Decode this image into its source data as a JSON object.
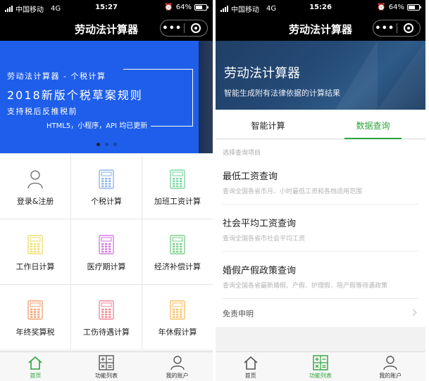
{
  "status_left": {
    "carrier": "中国移动",
    "network": "4G",
    "time": "15:27",
    "battery": "64%",
    "battery_level": 0.64
  },
  "status_right": {
    "carrier": "中国移动",
    "network": "4G",
    "time": "15:26",
    "battery": "64%",
    "battery_level": 0.64
  },
  "app": {
    "title": "劳动法计算器",
    "more_glyph": "•••",
    "close_icon": "target-circle-icon"
  },
  "banner": {
    "line1": "劳动法计算器 - 个税计算",
    "line2": "2018新版个税草案规则",
    "line3": "支持税后反推税前",
    "line4": "HTML5，小程序，API 均已更新",
    "slides": 3,
    "active_slide": 0,
    "background": "#1e5eea"
  },
  "grid": {
    "items": [
      {
        "label": "登录&注册",
        "icon": "user-icon",
        "color": "#666666"
      },
      {
        "label": "个税计算",
        "icon": "calculator-icon",
        "color": "#8fb4e8"
      },
      {
        "label": "加班工资计算",
        "icon": "calculator-icon",
        "color": "#7fd6a4"
      },
      {
        "label": "工作日计算",
        "icon": "calculator-icon",
        "color": "#f0e070"
      },
      {
        "label": "医疗期计算",
        "icon": "calculator-icon",
        "color": "#d27ee0"
      },
      {
        "label": "经济补偿计算",
        "icon": "calculator-icon",
        "color": "#7fcf8e"
      },
      {
        "label": "年终奖算税",
        "icon": "calculator-icon",
        "color": "#f2a477"
      },
      {
        "label": "工伤待遇计算",
        "icon": "calculator-icon",
        "color": "#f08a9a"
      },
      {
        "label": "年休假计算",
        "icon": "calculator-icon",
        "color": "#f6c36a"
      }
    ]
  },
  "tabbar": {
    "home": "首页",
    "functions": "功能列表",
    "account": "我的账户",
    "active_color": "#2ca43b"
  },
  "right": {
    "header_title": "劳动法计算器",
    "header_subtitle": "智能生成附有法律依据的计算结果",
    "seg_tabs": [
      "智能计算",
      "数据查询"
    ],
    "active_seg": 1,
    "caption": "选择查询项目",
    "items": [
      {
        "title": "最低工资查询",
        "desc": "查询全国各省市月、小时最低工资和各档适用范围"
      },
      {
        "title": "社会平均工资查询",
        "desc": "查询全国各省市社会平均工资"
      },
      {
        "title": "婚假产假政策查询",
        "desc": "查询全国各省最新婚假、产假、护理假、陪产假等待遇政策"
      }
    ],
    "disclaimer": "免责申明"
  }
}
